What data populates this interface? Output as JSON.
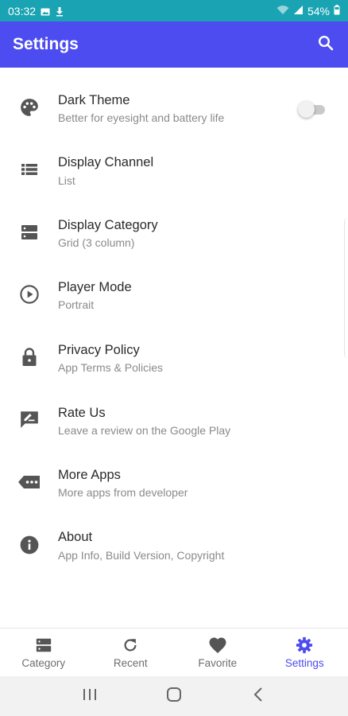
{
  "status_bar": {
    "time": "03:32",
    "battery": "54%",
    "bg_color": "#1aa3b2",
    "left_icons": [
      "image-icon",
      "download-icon"
    ],
    "right_icons": [
      "wifi-icon",
      "signal-icon",
      "battery-icon"
    ]
  },
  "app_bar": {
    "title": "Settings",
    "bg_color": "#4c4cf0",
    "action_icon": "search-icon"
  },
  "settings": {
    "items": [
      {
        "icon": "palette-icon",
        "title": "Dark Theme",
        "subtitle": "Better for eyesight and battery life",
        "toggle_on": false
      },
      {
        "icon": "list-icon",
        "title": "Display Channel",
        "subtitle": "List"
      },
      {
        "icon": "grid-icon",
        "title": "Display Category",
        "subtitle": "Grid (3 column)"
      },
      {
        "icon": "play-circle-icon",
        "title": "Player Mode",
        "subtitle": "Portrait"
      },
      {
        "icon": "lock-icon",
        "title": "Privacy Policy",
        "subtitle": "App Terms & Policies"
      },
      {
        "icon": "rate-review-icon",
        "title": "Rate Us",
        "subtitle": "Leave a review on the Google Play"
      },
      {
        "icon": "more-apps-icon",
        "title": "More Apps",
        "subtitle": "More apps from developer"
      },
      {
        "icon": "info-icon",
        "title": "About",
        "subtitle": "App Info, Build Version, Copyright"
      }
    ]
  },
  "bottom_nav": {
    "active_color": "#4c4cf0",
    "items": [
      {
        "icon": "category-icon",
        "label": "Category",
        "active": false
      },
      {
        "icon": "refresh-icon",
        "label": "Recent",
        "active": false
      },
      {
        "icon": "heart-icon",
        "label": "Favorite",
        "active": false
      },
      {
        "icon": "gear-icon",
        "label": "Settings",
        "active": true
      }
    ]
  },
  "system_nav": {
    "buttons": [
      "recent-apps-icon",
      "home-icon",
      "back-icon"
    ]
  }
}
